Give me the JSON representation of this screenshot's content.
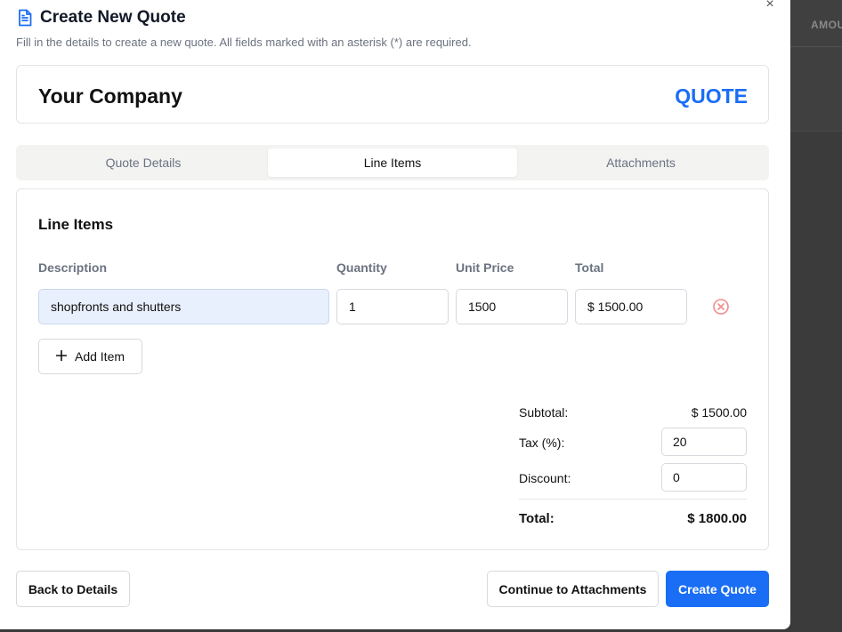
{
  "background": {
    "column_header": "AMOU"
  },
  "modal": {
    "title": "Create New Quote",
    "subtitle": "Fill in the details to create a new quote. All fields marked with an asterisk (*) are required.",
    "close_symbol": "×"
  },
  "company_card": {
    "company_name": "Your Company",
    "document_label": "QUOTE"
  },
  "tabs": [
    {
      "label": "Quote Details",
      "active": false
    },
    {
      "label": "Line Items",
      "active": true
    },
    {
      "label": "Attachments",
      "active": false
    }
  ],
  "line_items": {
    "section_title": "Line Items",
    "columns": {
      "description": "Description",
      "quantity": "Quantity",
      "unit_price": "Unit Price",
      "total": "Total"
    },
    "rows": [
      {
        "description": "shopfronts and shutters",
        "quantity": "1",
        "unit_price": "1500",
        "total": "$ 1500.00"
      }
    ],
    "add_item_label": "Add Item"
  },
  "summary": {
    "subtotal_label": "Subtotal:",
    "subtotal_value": "$ 1500.00",
    "tax_label": "Tax (%):",
    "tax_value": "20",
    "discount_label": "Discount:",
    "discount_value": "0",
    "total_label": "Total:",
    "total_value": "$ 1800.00"
  },
  "footer": {
    "back_label": "Back to Details",
    "continue_label": "Continue to Attachments",
    "create_label": "Create Quote"
  },
  "colors": {
    "accent": "#1a6ef5",
    "remove_icon": "#f08b8b",
    "description_fill": "#e8f0fd"
  },
  "icons": {
    "title": "document-icon",
    "remove": "x-circle-icon",
    "add": "plus-icon",
    "close": "close-icon"
  }
}
